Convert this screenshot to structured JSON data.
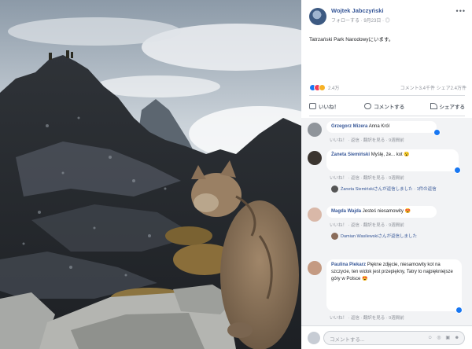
{
  "post": {
    "author": "Wojtek Jabczyński",
    "subtitle": "フォローする · 9月23日 · ◎",
    "caption": "Tatrzański Park Narodowyにいます。",
    "reactions_count": "2.4万",
    "stats_right": "コメント3.4千件 シェア2.4万件"
  },
  "actions": {
    "like": "いいね！",
    "comment": "コメントする",
    "share": "シェアする"
  },
  "comments": [
    {
      "author": "Grzegorz Mizera",
      "text": "Anna Król",
      "meta": "いいね！ · 返信 · 翻訳を見る · 9週間前"
    },
    {
      "author": "Żaneta Siemiński",
      "text": "Myślę, że... kot 😮",
      "meta": "いいね！ · 返信 · 翻訳を見る · 9週間前",
      "reply": "Żaneta Siemińskiさんが返信しました · 1件の返信"
    },
    {
      "author": "Magda Wajda",
      "text": "Jesteś niesamowity 😍",
      "meta": "いいね！ · 返信 · 翻訳を見る · 9週間前",
      "reply": "Damian Wasilewskiさんが返信しました"
    },
    {
      "author": "Paulina Piekarz",
      "text": "Piękne zdjęcie, niesamowity kot na szczycie, ten widok jest przepiękny, Tatry to najpiękniejsze góry w Polsce 😍",
      "meta": "いいね！ · 返信 · 翻訳を見る · 9週間前"
    }
  ],
  "composer": {
    "placeholder": "コメントする...",
    "icons": "☺ ◎ ▣ ☻"
  },
  "colors": {
    "link": "#385898",
    "accent": "#1877f2",
    "comment_bg": "#f2f3f5"
  },
  "icons": [
    "more-icon",
    "like-icon",
    "comment-icon",
    "share-icon",
    "love-reaction-icon",
    "wow-reaction-icon"
  ]
}
